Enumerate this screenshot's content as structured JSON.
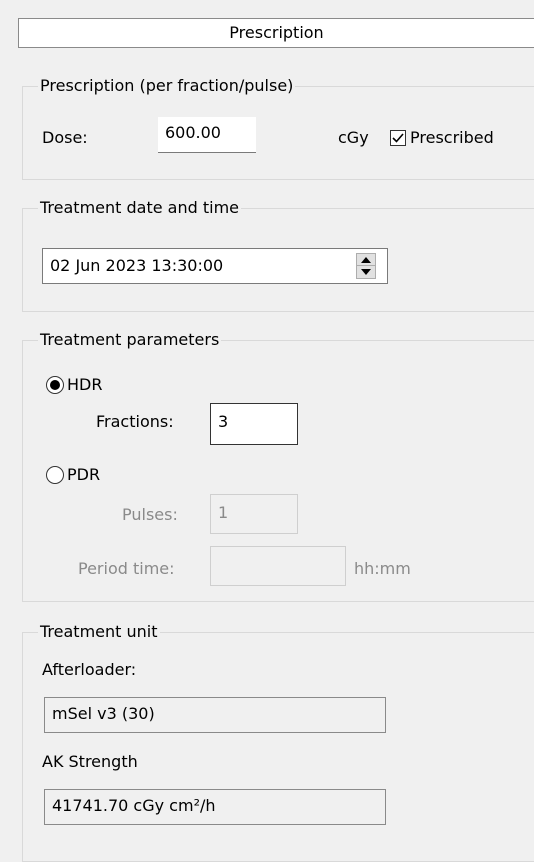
{
  "header": {
    "title": "Prescription"
  },
  "prescription_group": {
    "title": "Prescription (per fraction/pulse)",
    "dose_label": "Dose:",
    "dose_value": "600.00",
    "dose_unit": "cGy",
    "prescribed_label": "Prescribed",
    "prescribed_checked": true
  },
  "treatment_date_group": {
    "title": "Treatment date and time",
    "datetime_value": "02 Jun  2023 13:30:00"
  },
  "treatment_params_group": {
    "title": "Treatment parameters",
    "hdr_label": "HDR",
    "hdr_selected": true,
    "fractions_label": "Fractions:",
    "fractions_value": "3",
    "pdr_label": "PDR",
    "pdr_selected": false,
    "pulses_label": "Pulses:",
    "pulses_value": "1",
    "period_label": "Period time:",
    "period_value": "",
    "period_unit": "hh:mm"
  },
  "treatment_unit_group": {
    "title": "Treatment unit",
    "afterloader_label": "Afterloader:",
    "afterloader_value": "mSel v3 (30)",
    "ak_label": "AK Strength",
    "ak_value": "41741.70 cGy cm²/h"
  }
}
